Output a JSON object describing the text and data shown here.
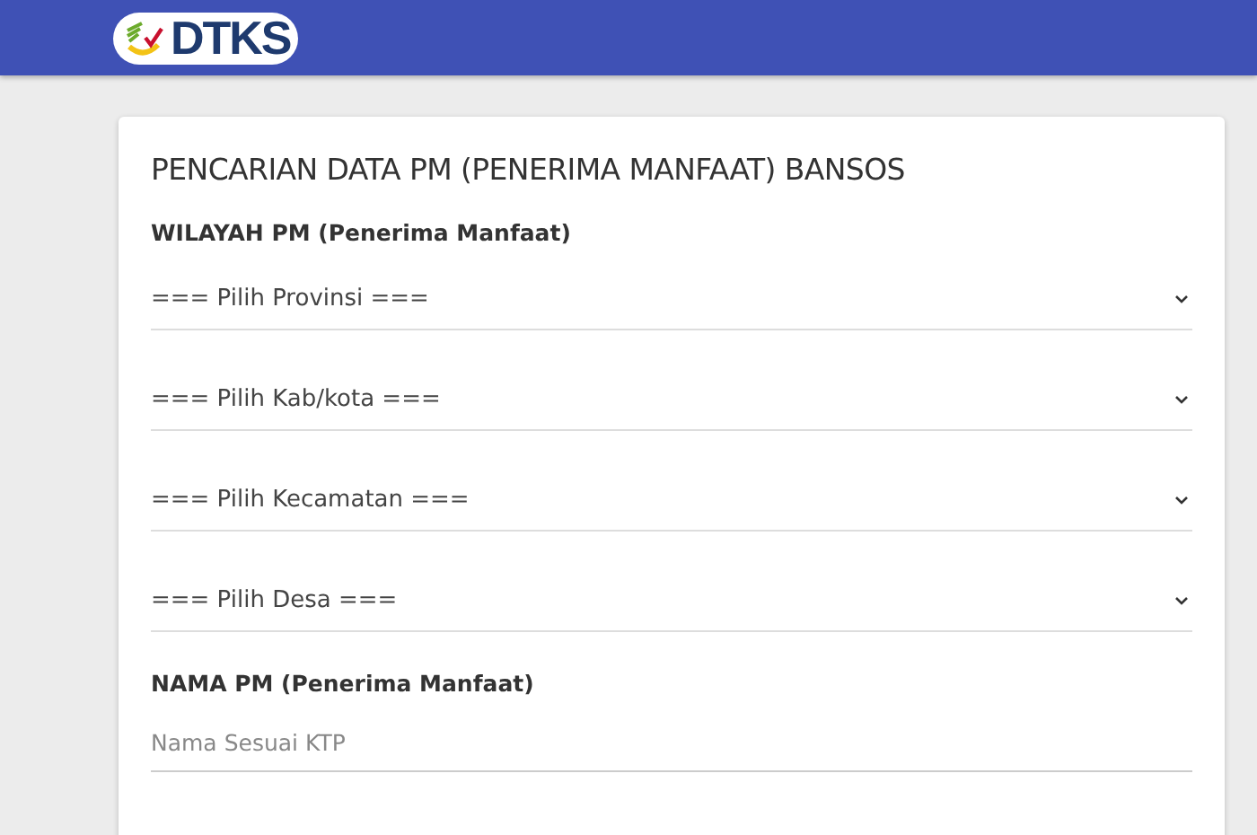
{
  "header": {
    "logo_text": "DTKS"
  },
  "form": {
    "title": "PENCARIAN DATA PM (PENERIMA MANFAAT) BANSOS",
    "region_label": "WILAYAH PM (Penerima Manfaat)",
    "selects": [
      {
        "placeholder": "=== Pilih Provinsi ==="
      },
      {
        "placeholder": "=== Pilih Kab/kota ==="
      },
      {
        "placeholder": "=== Pilih Kecamatan ==="
      },
      {
        "placeholder": "=== Pilih Desa ==="
      }
    ],
    "name_label": "NAMA PM (Penerima Manfaat)",
    "name_input": {
      "placeholder": "Nama Sesuai KTP"
    }
  }
}
